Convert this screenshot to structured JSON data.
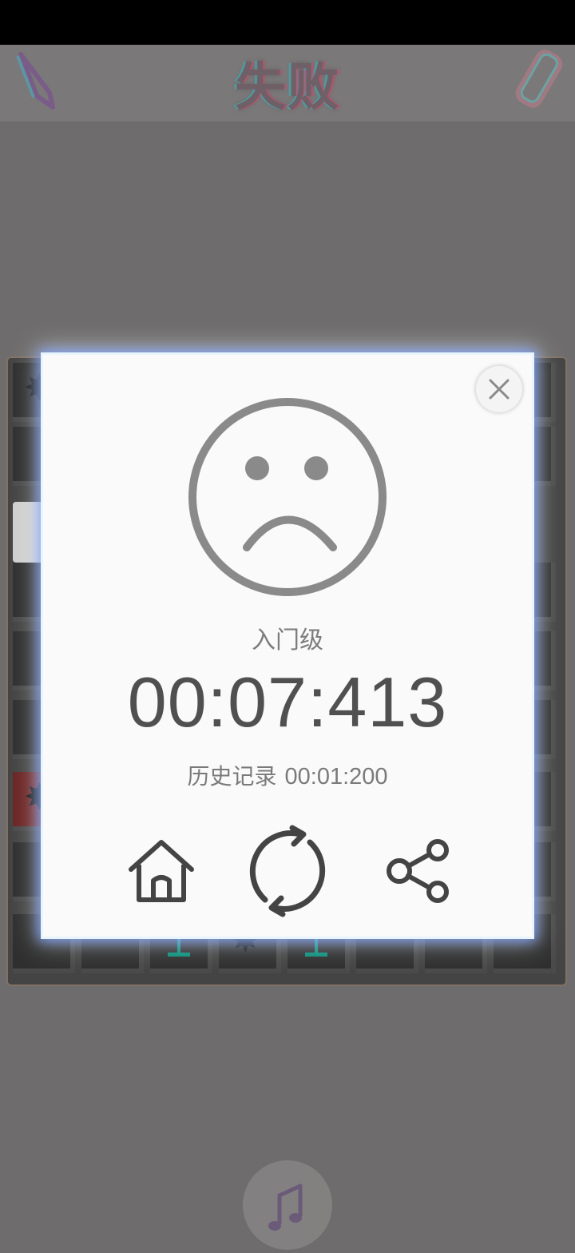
{
  "header": {
    "title": "失败"
  },
  "dialog": {
    "difficulty": "入门级",
    "elapsed_time": "00:07:413",
    "history_label": "历史记录",
    "history_time": "00:01:200"
  },
  "icons": {
    "close": "close-icon",
    "face": "sad-face-icon",
    "home": "home-icon",
    "restart": "refresh-icon",
    "share": "share-icon",
    "edit": "pencil-icon",
    "clear": "eraser-icon",
    "music": "music-note-icon"
  },
  "colors": {
    "overlay": "#6e6c6c",
    "dialog_bg": "#fafafa",
    "icon_gray": "#8a8a8a",
    "text_dark": "#505050",
    "flag_green": "#0b8e7a"
  }
}
